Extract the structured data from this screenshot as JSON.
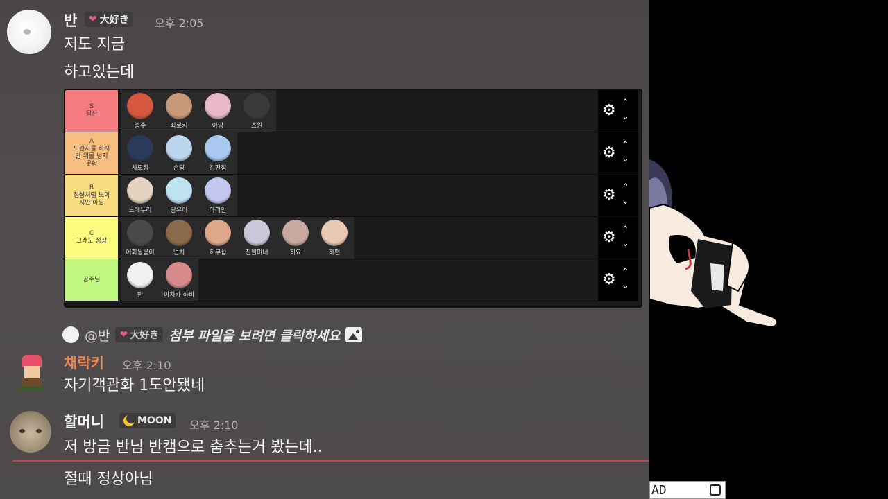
{
  "messages": [
    {
      "author": "반",
      "badge": "大好き",
      "timestamp": "오후 2:05",
      "lines": [
        "저도 지금",
        "하고있는데"
      ]
    },
    {
      "author": "채락키",
      "timestamp": "오후 2:10",
      "reply": {
        "mention": "@반",
        "badge": "大好き",
        "text": "첨부 파일을 보려면 클릭하세요"
      },
      "lines": [
        "자기객관화 1도안됐네"
      ]
    },
    {
      "author": "할머니",
      "badge": "MOON",
      "timestamp": "오후 2:10",
      "lines": [
        "저 방금 반님 반캠으로 춤추는거 봤는데..",
        "절때 정상아님"
      ]
    }
  ],
  "tierlist": {
    "rows": [
      {
        "label_lines": [
          "S",
          "될산"
        ],
        "color": "#f47c7f",
        "items": [
          {
            "name": "증주",
            "color": "#d6573f"
          },
          {
            "name": "좌로키",
            "color": "#c89a7a"
          },
          {
            "name": "아망",
            "color": "#e8b8c9"
          },
          {
            "name": "츠원",
            "color": "#3a3a3a"
          }
        ]
      },
      {
        "label_lines": [
          "A",
          "도련자들 하지",
          "만 위를 넘지",
          "못함"
        ],
        "color": "#f8be7f",
        "items": [
          {
            "name": "사모정",
            "color": "#2a3a5a"
          },
          {
            "name": "손랑",
            "color": "#bcd6f0"
          },
          {
            "name": "김편집",
            "color": "#a9c8ef"
          }
        ]
      },
      {
        "label_lines": [
          "B",
          "정상처럼 보이",
          "지만 아님"
        ],
        "color": "#f9dd82",
        "items": [
          {
            "name": "느에누리",
            "color": "#e5d2c0"
          },
          {
            "name": "당유이",
            "color": "#bfe3f3"
          },
          {
            "name": "마리안",
            "color": "#c4c8f0"
          }
        ]
      },
      {
        "label_lines": [
          "C",
          "그래도 정상"
        ],
        "color": "#fbfb80",
        "items": [
          {
            "name": "어화몽몽이",
            "color": "#4a4a4a"
          },
          {
            "name": "넌치",
            "color": "#8a6a4a"
          },
          {
            "name": "히무섭",
            "color": "#e0a88a"
          },
          {
            "name": "진월미너",
            "color": "#c8c8d8"
          },
          {
            "name": "히요",
            "color": "#c9a9a0"
          },
          {
            "name": "하편",
            "color": "#e8c8b0"
          }
        ]
      },
      {
        "label_lines": [
          "공주님"
        ],
        "color": "#bff77f",
        "items": [
          {
            "name": "반",
            "color": "#f0f0f0"
          },
          {
            "name": "이치카 하비",
            "color": "#d88a8a"
          }
        ]
      }
    ]
  },
  "colors": {
    "accent_orange": "#f0844a",
    "divider_red": "#c8434f",
    "moon_badge": "#f4c531",
    "heart": "#e05a8a"
  },
  "icons": [
    "gear-icon",
    "chevron-up-icon",
    "chevron-down-icon",
    "image-icon",
    "heart-icon",
    "moon-icon"
  ],
  "overlay": {
    "text": "AD"
  }
}
